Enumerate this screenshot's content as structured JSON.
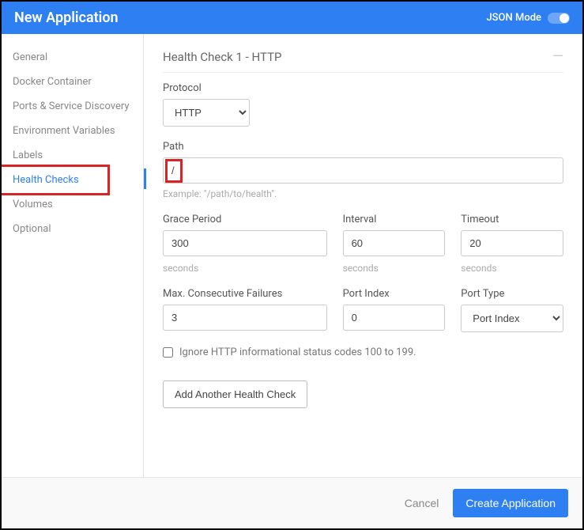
{
  "header": {
    "title": "New Application",
    "json_mode_label": "JSON Mode"
  },
  "sidebar": {
    "items": [
      {
        "label": "General"
      },
      {
        "label": "Docker Container"
      },
      {
        "label": "Ports & Service Discovery"
      },
      {
        "label": "Environment Variables"
      },
      {
        "label": "Labels"
      },
      {
        "label": "Health Checks"
      },
      {
        "label": "Volumes"
      },
      {
        "label": "Optional"
      }
    ],
    "active_index": 5
  },
  "form": {
    "section_title": "Health Check 1 - HTTP",
    "protocol": {
      "label": "Protocol",
      "value": "HTTP"
    },
    "path": {
      "label": "Path",
      "value": "/",
      "help": "Example: \"/path/to/health\"."
    },
    "grace_period": {
      "label": "Grace Period",
      "value": "300",
      "unit": "seconds"
    },
    "interval": {
      "label": "Interval",
      "value": "60",
      "unit": "seconds"
    },
    "timeout": {
      "label": "Timeout",
      "value": "20",
      "unit": "seconds"
    },
    "max_failures": {
      "label": "Max. Consecutive Failures",
      "value": "3"
    },
    "port_index": {
      "label": "Port Index",
      "value": "0"
    },
    "port_type": {
      "label": "Port Type",
      "value": "Port Index"
    },
    "ignore_info_label": "Ignore HTTP informational status codes 100 to 199.",
    "add_button": "Add Another Health Check"
  },
  "footer": {
    "cancel": "Cancel",
    "create": "Create Application"
  }
}
